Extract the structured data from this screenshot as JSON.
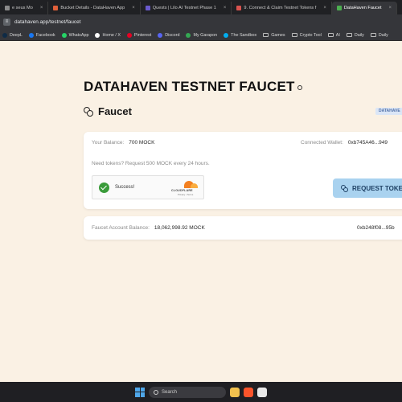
{
  "browser": {
    "tabs": [
      {
        "title": "e seus Mo",
        "color": "#8b8b8b",
        "active": false
      },
      {
        "title": "Bucket Details - DataHaven App",
        "color": "#e0603a",
        "active": false
      },
      {
        "title": "Quests | Lilo AI Testnet Phase 1",
        "color": "#6a5acd",
        "active": false
      },
      {
        "title": "9. Connect & Claim Testnet Tokens f",
        "color": "#d9534f",
        "active": false
      },
      {
        "title": "DataHaven Faucet",
        "color": "#4caf50",
        "active": true
      }
    ],
    "url": "datahaven.app/testnet/faucet",
    "bookmarks": [
      {
        "label": "DeepL",
        "icon": "deepl-icon",
        "color": "#0f2b46",
        "folder": false
      },
      {
        "label": "Facebook",
        "icon": "facebook-icon",
        "color": "#1877f2",
        "folder": false
      },
      {
        "label": "WhatsApp",
        "icon": "whatsapp-icon",
        "color": "#25d366",
        "folder": false
      },
      {
        "label": "Home / X",
        "icon": "x-icon",
        "color": "#ffffff",
        "folder": false
      },
      {
        "label": "Pinterest",
        "icon": "pinterest-icon",
        "color": "#e60023",
        "folder": false
      },
      {
        "label": "Discord",
        "icon": "discord-icon",
        "color": "#5865f2",
        "folder": false
      },
      {
        "label": "My Garapon",
        "icon": "garapon-icon",
        "color": "#34a853",
        "folder": false
      },
      {
        "label": "The Sandbox",
        "icon": "sandbox-icon",
        "color": "#00adef",
        "folder": false
      },
      {
        "label": "Games",
        "icon": "folder-icon",
        "color": "#bdbdbd",
        "folder": true
      },
      {
        "label": "Crypto Tool",
        "icon": "folder-icon",
        "color": "#bdbdbd",
        "folder": true
      },
      {
        "label": "AI",
        "icon": "folder-icon",
        "color": "#bdbdbd",
        "folder": true
      },
      {
        "label": "Daily",
        "icon": "folder-icon",
        "color": "#bdbdbd",
        "folder": true
      },
      {
        "label": "Daily",
        "icon": "folder-icon",
        "color": "#bdbdbd",
        "folder": true
      }
    ]
  },
  "page": {
    "title": "DATAHAVEN TESTNET FAUCET",
    "section_title": "Faucet",
    "network_badge": "DATAHAVE",
    "balance_label": "Your Balance:",
    "balance_value": "700 MOCK",
    "wallet_label": "Connected Wallet:",
    "wallet_value": "0xb745A46...949",
    "info_text": "Need tokens? Request 500 MOCK every 24 hours.",
    "captcha": {
      "status": "Success!",
      "brand": "CLOUDFLARE",
      "links": "Privacy  •  Terms"
    },
    "request_button": "REQUEST TOKE",
    "faucet_label": "Faucet Account Balance:",
    "faucet_value": "18,062,998.92 MOCK",
    "faucet_address": "0xb248f08...95b"
  },
  "taskbar": {
    "search_placeholder": "Search"
  },
  "colors": {
    "page_bg": "#faf1e4",
    "accent_button": "#a9d2ef",
    "success": "#3a9b3a",
    "cloudflare": "#f38020"
  }
}
